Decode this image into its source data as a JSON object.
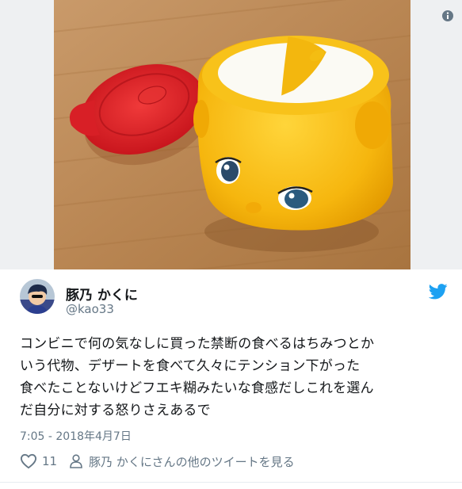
{
  "tweet": {
    "display_name": "豚乃 かくに",
    "handle": "@kao33",
    "text_lines": [
      "コンビニで何の気なしに買った禁断の食べるはちみつとか",
      "いう代物、デザートを食べて久々にテンション下がった",
      "食べたことないけどフエキ糊みたいな食感だしこれを選ん",
      "だ自分に対する怒りさえあるで"
    ],
    "timestamp": "7:05 - 2018年4月7日",
    "like_count": "11",
    "more_tweets_label": "豚乃 かくにさんの他のツイートを見る"
  },
  "icons": {
    "info": "info-icon",
    "brand": "twitter-bird-icon",
    "like": "heart-icon",
    "profile": "person-icon"
  },
  "colors": {
    "twitter_blue": "#1da1f2",
    "secondary_text": "#657786",
    "lid_red": "#d81f26",
    "container_yellow": "#f6b60e"
  }
}
